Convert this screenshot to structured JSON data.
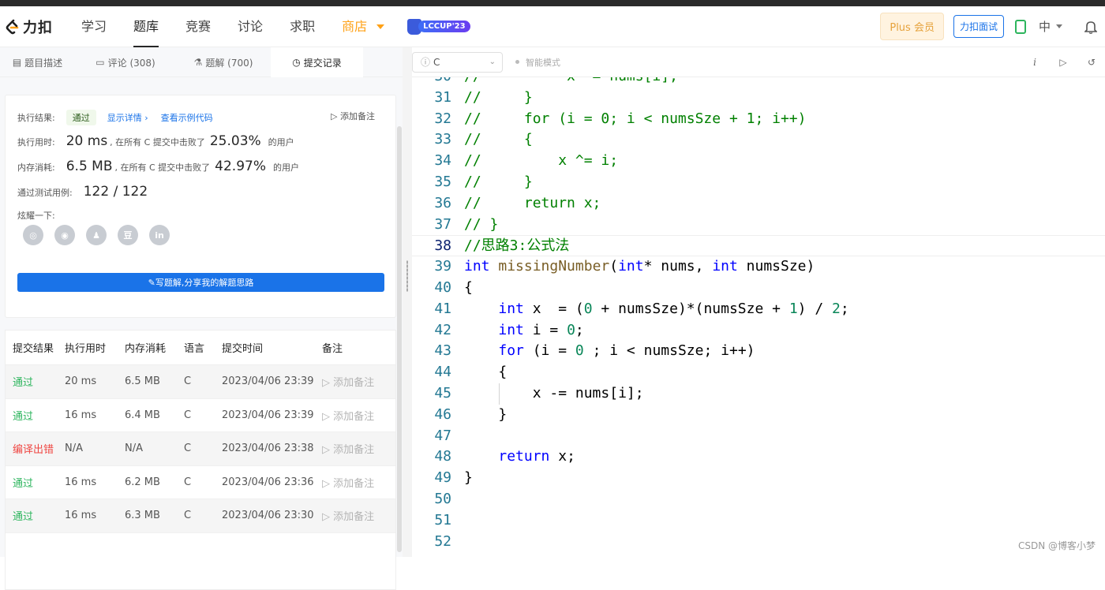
{
  "nav": {
    "logo_text": "力扣",
    "items": [
      "学习",
      "题库",
      "竞赛",
      "讨论",
      "求职"
    ],
    "active": "题库",
    "store": "商店",
    "lccup": "LCCUP'23",
    "plus": "Plus 会员",
    "mock": "力扣面试",
    "lang": "中"
  },
  "tabs": [
    {
      "icon": "▤",
      "label": "题目描述"
    },
    {
      "icon": "▭",
      "label": "评论 (308)"
    },
    {
      "icon": "⚗",
      "label": "题解 (700)"
    },
    {
      "icon": "◷",
      "label": "提交记录"
    }
  ],
  "result": {
    "label": "执行结果:",
    "status": "通过",
    "detail_link": "显示详情 ›",
    "sample_link": "查看示例代码",
    "add_note": "添加备注",
    "time_label": "执行用时:",
    "time_value": "20 ms",
    "time_text": ", 在所有 C 提交中击败了",
    "time_pct": "25.03%",
    "time_suffix": "的用户",
    "mem_label": "内存消耗:",
    "mem_value": "6.5 MB",
    "mem_text": ", 在所有 C 提交中击败了",
    "mem_pct": "42.97%",
    "mem_suffix": "的用户",
    "cases_label": "通过测试用例:",
    "cases_value": "122  /  122",
    "share_label": "炫耀一下:",
    "share_icons": [
      "wechat-icon",
      "weibo-icon",
      "qq-icon",
      "douban-icon",
      "linkedin-icon"
    ],
    "share_glyphs": [
      "◎",
      "◉",
      "♟",
      "豆",
      "in"
    ],
    "write_button": "写题解,分享我的解题思路"
  },
  "submissions": {
    "headers": [
      "提交结果",
      "执行用时",
      "内存消耗",
      "语言",
      "提交时间",
      "备注"
    ],
    "rows": [
      {
        "status": "通过",
        "ok": true,
        "time": "20 ms",
        "mem": "6.5 MB",
        "lang": "C",
        "date": "2023/04/06 23:39",
        "note": "添加备注"
      },
      {
        "status": "通过",
        "ok": true,
        "time": "16 ms",
        "mem": "6.4 MB",
        "lang": "C",
        "date": "2023/04/06 23:39",
        "note": "添加备注"
      },
      {
        "status": "编译出错",
        "ok": false,
        "time": "N/A",
        "mem": "N/A",
        "lang": "C",
        "date": "2023/04/06 23:38",
        "note": "添加备注"
      },
      {
        "status": "通过",
        "ok": true,
        "time": "16 ms",
        "mem": "6.2 MB",
        "lang": "C",
        "date": "2023/04/06 23:36",
        "note": "添加备注"
      },
      {
        "status": "通过",
        "ok": true,
        "time": "16 ms",
        "mem": "6.3 MB",
        "lang": "C",
        "date": "2023/04/06 23:30",
        "note": "添加备注"
      }
    ]
  },
  "editor": {
    "language": "C",
    "language_icon": "ⓘ",
    "smart_mode": "智能模式",
    "current_line": 38,
    "lines": [
      {
        "n": 30,
        "parts": [
          [
            "cm",
            "//          x ^= nums[i];"
          ]
        ]
      },
      {
        "n": 31,
        "parts": [
          [
            "cm",
            "//     }"
          ]
        ]
      },
      {
        "n": 32,
        "parts": [
          [
            "cm",
            "//     for (i = 0; i < numsSze + 1; i++)"
          ]
        ]
      },
      {
        "n": 33,
        "parts": [
          [
            "cm",
            "//     {"
          ]
        ]
      },
      {
        "n": 34,
        "parts": [
          [
            "cm",
            "//         x ^= i;"
          ]
        ]
      },
      {
        "n": 35,
        "parts": [
          [
            "cm",
            "//     }"
          ]
        ]
      },
      {
        "n": 36,
        "parts": [
          [
            "cm",
            "//     return x;"
          ]
        ]
      },
      {
        "n": 37,
        "parts": [
          [
            "cm",
            "// }"
          ]
        ]
      },
      {
        "n": 38,
        "parts": [
          [
            "cm",
            "//思路3:公式法"
          ]
        ]
      },
      {
        "n": 39,
        "parts": [
          [
            "kw",
            "int "
          ],
          [
            "fn",
            "missingNumber"
          ],
          [
            "tx",
            "("
          ],
          [
            "kw",
            "int"
          ],
          [
            "tx",
            "* nums, "
          ],
          [
            "kw",
            "int"
          ],
          [
            "tx",
            " numsSze)"
          ]
        ]
      },
      {
        "n": 40,
        "parts": [
          [
            "tx",
            "{"
          ]
        ]
      },
      {
        "n": 41,
        "parts": [
          [
            "tx",
            "    "
          ],
          [
            "kw",
            "int"
          ],
          [
            "tx",
            " x  = ("
          ],
          [
            "num",
            "0"
          ],
          [
            "tx",
            " + numsSze)*(numsSze + "
          ],
          [
            "num",
            "1"
          ],
          [
            "tx",
            ") / "
          ],
          [
            "num",
            "2"
          ],
          [
            "tx",
            ";"
          ]
        ]
      },
      {
        "n": 42,
        "parts": [
          [
            "tx",
            "    "
          ],
          [
            "kw",
            "int"
          ],
          [
            "tx",
            " i = "
          ],
          [
            "num",
            "0"
          ],
          [
            "tx",
            ";"
          ]
        ]
      },
      {
        "n": 43,
        "parts": [
          [
            "tx",
            "    "
          ],
          [
            "kw",
            "for"
          ],
          [
            "tx",
            " (i = "
          ],
          [
            "num",
            "0"
          ],
          [
            "tx",
            " ; i < numsSze; i++)"
          ]
        ]
      },
      {
        "n": 44,
        "parts": [
          [
            "tx",
            "    {"
          ]
        ]
      },
      {
        "n": 45,
        "parts": [
          [
            "tx",
            "        x -= nums[i];"
          ]
        ]
      },
      {
        "n": 46,
        "parts": [
          [
            "tx",
            "    }"
          ]
        ]
      },
      {
        "n": 47,
        "parts": [
          [
            "tx",
            ""
          ]
        ]
      },
      {
        "n": 48,
        "parts": [
          [
            "tx",
            "    "
          ],
          [
            "kw",
            "return"
          ],
          [
            "tx",
            " x;"
          ]
        ]
      },
      {
        "n": 49,
        "parts": [
          [
            "tx",
            "}"
          ]
        ]
      },
      {
        "n": 50,
        "parts": [
          [
            "tx",
            ""
          ]
        ]
      },
      {
        "n": 51,
        "parts": [
          [
            "tx",
            ""
          ]
        ]
      },
      {
        "n": 52,
        "parts": [
          [
            "tx",
            ""
          ]
        ]
      }
    ]
  },
  "watermark": "CSDN @博客小梦"
}
